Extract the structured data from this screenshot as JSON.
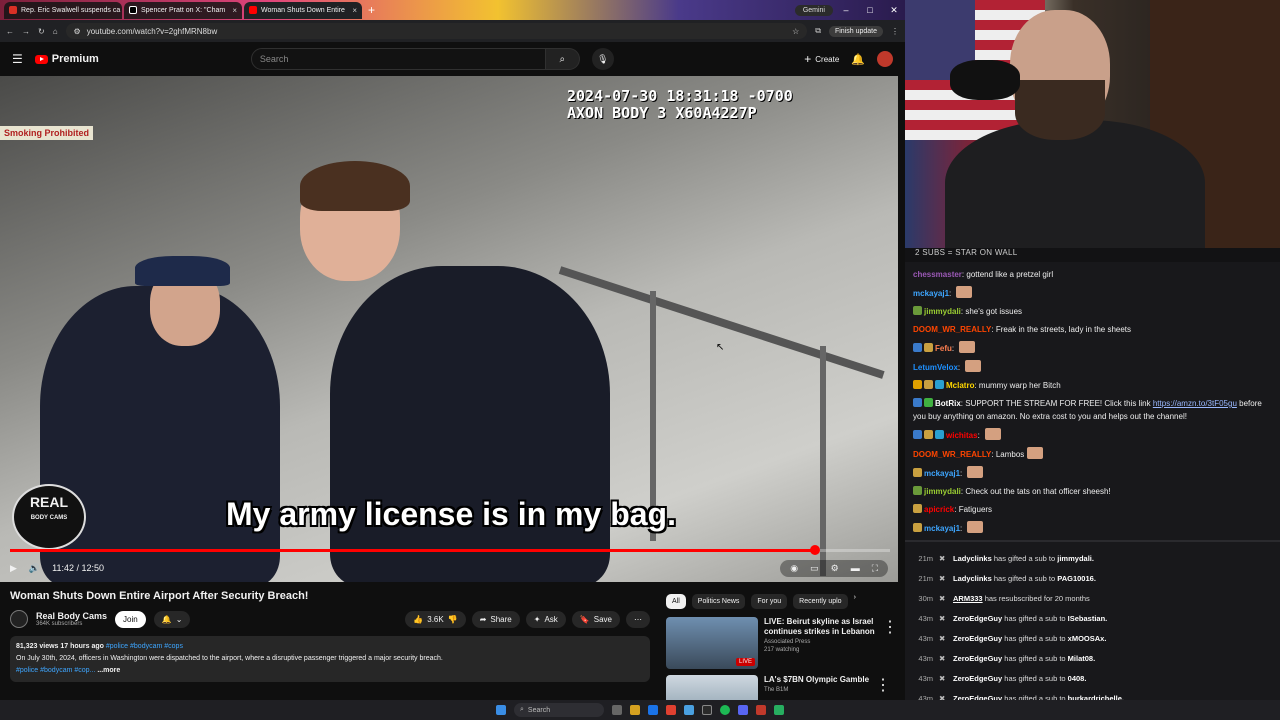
{
  "browser": {
    "tabs": [
      {
        "label": "Rep. Eric Swalwell suspends ca",
        "color": "#d93025"
      },
      {
        "label": "Spencer Pratt on X: \"Cham",
        "color": "#000000"
      },
      {
        "label": "Woman Shuts Down Entire",
        "color": "#ff0000"
      }
    ],
    "new_tab": "+",
    "gemini": "Gemini",
    "url": "youtube.com/watch?v=2ghfMRN8bw",
    "finish_update": "Finish update"
  },
  "youtube": {
    "brand": "Premium",
    "search_placeholder": "Search",
    "create_label": "Create",
    "video": {
      "timestamp_line1": "2024-07-30 18:31:18 -0700",
      "timestamp_line2": "AXON BODY 3 X60A4227P",
      "sign": "Smoking Prohibited",
      "caption": "My army license is in my bag.",
      "logo_line1": "REAL",
      "logo_line2": "BODY CAMS",
      "time": "11:42 / 12:50",
      "progress": 0.915
    },
    "title": "Woman Shuts Down Entire Airport After Security Breach!",
    "channel": {
      "name": "Real Body Cams",
      "subscribers": "364K subscribers",
      "join": "Join"
    },
    "actions": {
      "likes": "3.6K",
      "share": "Share",
      "ask": "Ask",
      "save": "Save"
    },
    "description": {
      "meta": "81,323 views  17 hours ago",
      "hashtags": "#police #bodycam #cops",
      "text": "On July 30th, 2024, officers in Washington were dispatched to the airport, where a disruptive passenger triggered a major security breach.",
      "tags_line": "#police #bodycam #cop...",
      "more": "...more"
    },
    "chips": [
      "All",
      "Politics News",
      "For you",
      "Recently uplo"
    ],
    "related": [
      {
        "title": "LIVE: Beirut skyline as Israel continues strikes in Lebanon",
        "channel": "Associated Press",
        "meta": "217 watching",
        "badge": "LIVE"
      },
      {
        "title": "LA's $7BN Olympic Gamble",
        "channel": "The B1M",
        "meta": "",
        "badge": ""
      }
    ]
  },
  "chat": {
    "goal": "2 SUBS = STAR ON WALL",
    "messages": [
      {
        "user": "chessmaster",
        "color": "#9b59b6",
        "text": "gottend like a pretzel girl"
      },
      {
        "user": "mckayaj1",
        "color": "#3ea6ff",
        "text": ""
      },
      {
        "user": "jimmydali",
        "color": "#9acd32",
        "text": "she's got issues"
      },
      {
        "user": "DOOM_WR_REALLY",
        "color": "#ff4500",
        "text": "Freak in the streets, lady in the sheets"
      },
      {
        "user": "Fefu",
        "color": "#ff7f50",
        "text": ""
      },
      {
        "user": "LetumVelox",
        "color": "#1e90ff",
        "text": ""
      },
      {
        "user": "Mclatro",
        "color": "#ffd700",
        "text": "mummy warp her Bitch"
      },
      {
        "user": "BotRix",
        "color": "#ffffff",
        "text": "SUPPORT THE STREAM FOR FREE! Click this link",
        "link": "https://amzn.to/3tF05gu",
        "text2": "before you buy anything on amazon. No extra cost to you and helps out the channel!"
      },
      {
        "user": "wichitas",
        "color": "#ff0000",
        "text": ""
      },
      {
        "user": "DOOM_WR_REALLY",
        "color": "#ff4500",
        "text": "Lambos"
      },
      {
        "user": "mckayaj1",
        "color": "#3ea6ff",
        "text": ""
      },
      {
        "user": "jimmydali",
        "color": "#9acd32",
        "text": "Check out the tats on that officer sheesh!"
      },
      {
        "user": "apicrick",
        "color": "#ff0000",
        "text": "Fatiguers"
      },
      {
        "user": "mckayaj1",
        "color": "#3ea6ff",
        "text": ""
      }
    ],
    "events": [
      {
        "time": "21m",
        "user": "Ladyclinks",
        "action": "has gifted a sub to",
        "target": "jimmydali."
      },
      {
        "time": "21m",
        "user": "Ladyclinks",
        "action": "has gifted a sub to",
        "target": "PAG10016."
      },
      {
        "time": "30m",
        "user": "ARM333",
        "action": "has resubscribed for 20 months",
        "target": ""
      },
      {
        "time": "43m",
        "user": "ZeroEdgeGuy",
        "action": "has gifted a sub to",
        "target": "ISebastian."
      },
      {
        "time": "43m",
        "user": "ZeroEdgeGuy",
        "action": "has gifted a sub to",
        "target": "xMOOSAx."
      },
      {
        "time": "43m",
        "user": "ZeroEdgeGuy",
        "action": "has gifted a sub to",
        "target": "Milat08."
      },
      {
        "time": "43m",
        "user": "ZeroEdgeGuy",
        "action": "has gifted a sub to",
        "target": "0408."
      },
      {
        "time": "43m",
        "user": "ZeroEdgeGuy",
        "action": "has gifted a sub to",
        "target": "burkardrichelle."
      }
    ]
  },
  "taskbar": {
    "search": "Search"
  }
}
